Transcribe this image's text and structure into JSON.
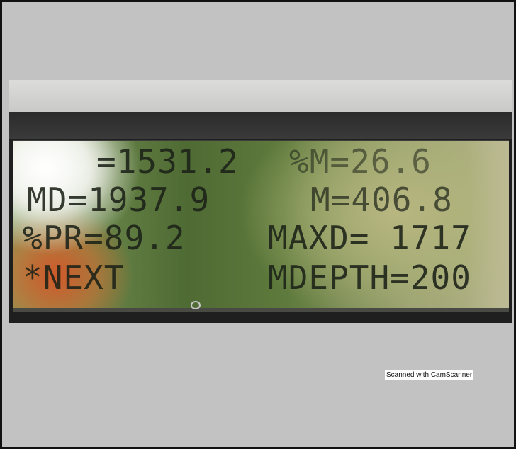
{
  "lcd": {
    "rows": [
      {
        "left": "=1531.2",
        "right": "%M=26.6"
      },
      {
        "left": "MD=1937.9",
        "right": "M=406.8"
      },
      {
        "left": "%PR=89.2",
        "right": "MAXD= 1717"
      },
      {
        "left": "*NEXT",
        "right": "MDEPTH=200"
      }
    ]
  },
  "watermark": "Scanned with CamScanner"
}
